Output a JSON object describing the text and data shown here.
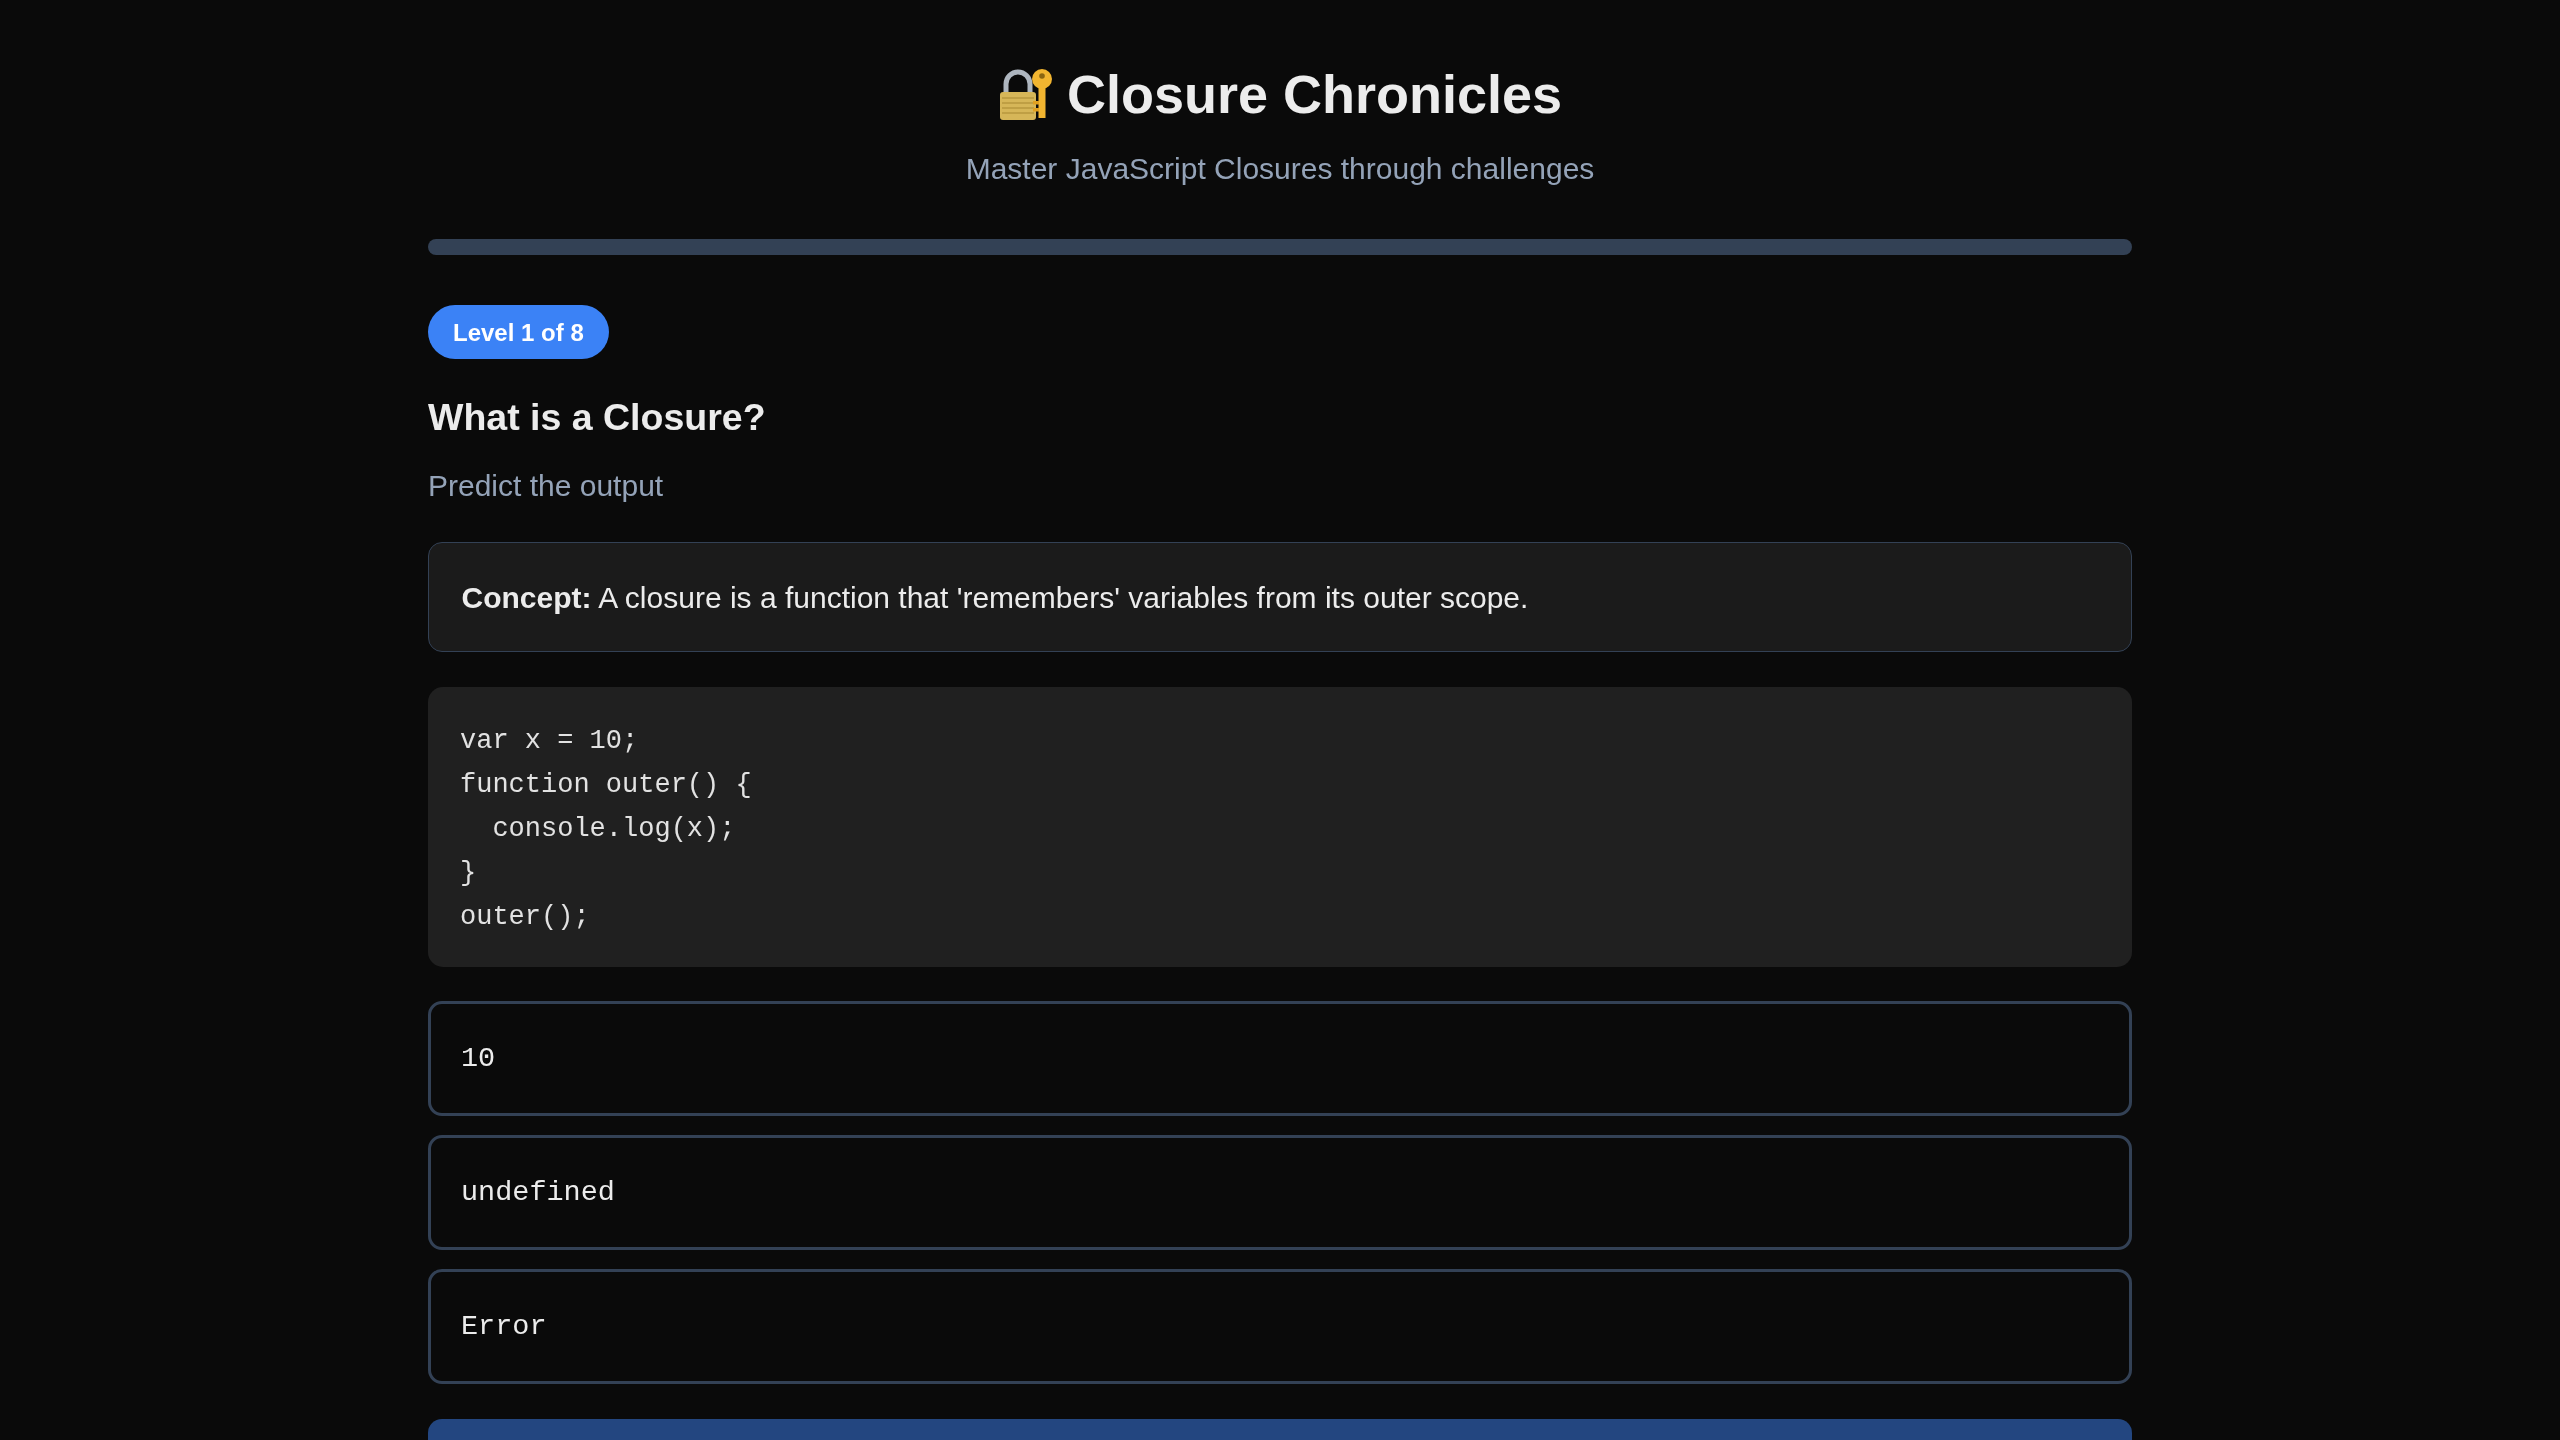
{
  "header": {
    "title": "Closure Chronicles",
    "subtitle": "Master JavaScript Closures through challenges"
  },
  "progress": {
    "level": 0
  },
  "level_badge": "Level 1 of 8",
  "challenge": {
    "title": "What is a Closure?",
    "prompt": "Predict the output",
    "concept": "**Concept:** A closure is a function that 'remembers' variables from its outer scope.",
    "code_lines": [
      "var x = 10;",
      "function outer() {",
      "  console.log(x);",
      "}",
      "outer();"
    ],
    "options": [
      {
        "label": "10",
        "selected": false
      },
      {
        "label": "undefined",
        "selected": false
      },
      {
        "label": "Error",
        "selected": false
      }
    ]
  },
  "action_button": {
    "disabled": true
  }
}
